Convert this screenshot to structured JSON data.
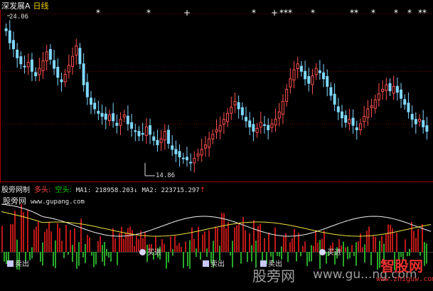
{
  "main_chart": {
    "stock_name": "深发展A",
    "period": "日线",
    "high_label": "24.06",
    "low_label": "14.86",
    "signal_markers": [
      "*",
      "*",
      "+",
      "*",
      "+",
      "***",
      "*",
      "**",
      "*",
      "*",
      "*",
      "**"
    ],
    "colors": {
      "up": "#ff5050",
      "down": "#7fd8ff",
      "grid": "#7a0000",
      "axis": "#b00000"
    },
    "price_range": [
      14.0,
      25.0
    ],
    "closes": [
      23.8,
      23.0,
      22.6,
      22.0,
      21.6,
      21.4,
      21.7,
      21.1,
      20.8,
      21.3,
      21.8,
      22.4,
      21.9,
      21.3,
      20.7,
      20.4,
      20.9,
      21.5,
      22.1,
      22.8,
      21.6,
      20.2,
      19.4,
      18.9,
      18.6,
      18.3,
      18.1,
      17.9,
      18.2,
      17.8,
      17.5,
      17.9,
      18.2,
      17.6,
      17.3,
      17.1,
      16.8,
      16.9,
      17.4,
      16.9,
      16.5,
      16.2,
      16.6,
      17.1,
      16.3,
      15.9,
      15.6,
      15.4,
      15.3,
      15.2,
      15.0,
      15.3,
      15.6,
      15.9,
      16.2,
      16.6,
      16.9,
      17.2,
      17.5,
      17.9,
      18.3,
      18.7,
      19.1,
      18.6,
      18.2,
      17.8,
      17.4,
      17.1,
      17.3,
      17.7,
      17.5,
      17.2,
      17.6,
      17.9,
      18.4,
      19.1,
      19.9,
      20.6,
      21.2,
      21.6,
      21.1,
      20.6,
      20.3,
      20.8,
      21.3,
      21.0,
      20.6,
      20.1,
      19.5,
      18.9,
      18.4,
      18.0,
      17.7,
      17.9,
      17.5,
      17.2,
      17.6,
      18.1,
      18.6,
      18.8,
      19.2,
      19.6,
      19.9,
      20.2,
      19.8,
      20.1,
      19.7,
      19.3,
      18.9,
      18.4,
      17.9,
      17.6,
      17.9,
      17.4,
      17.1
    ]
  },
  "indicator_panel": {
    "name": "股旁网制",
    "bull_label": "多头:",
    "bear_label": "空头:",
    "ma1_text": "MA1: 218958.203↓",
    "ma2_text": "MA2: 223715.297",
    "ma2_arrow": "↑",
    "site_name": "股旁网",
    "site_url": "www.gupang.com",
    "signals": [
      {
        "text": "卖出",
        "marker": "box"
      },
      {
        "text": "买进",
        "marker": "dot"
      },
      {
        "text": "卖出",
        "marker": "box"
      },
      {
        "text": "卖出",
        "marker": "box"
      },
      {
        "text": "买进",
        "marker": "dot"
      }
    ]
  },
  "watermarks": {
    "w1": "股旁网",
    "w2": "www.gu...ng.com",
    "logo_big": "智股网",
    "logo_small": "www.zhiguw.com"
  }
}
